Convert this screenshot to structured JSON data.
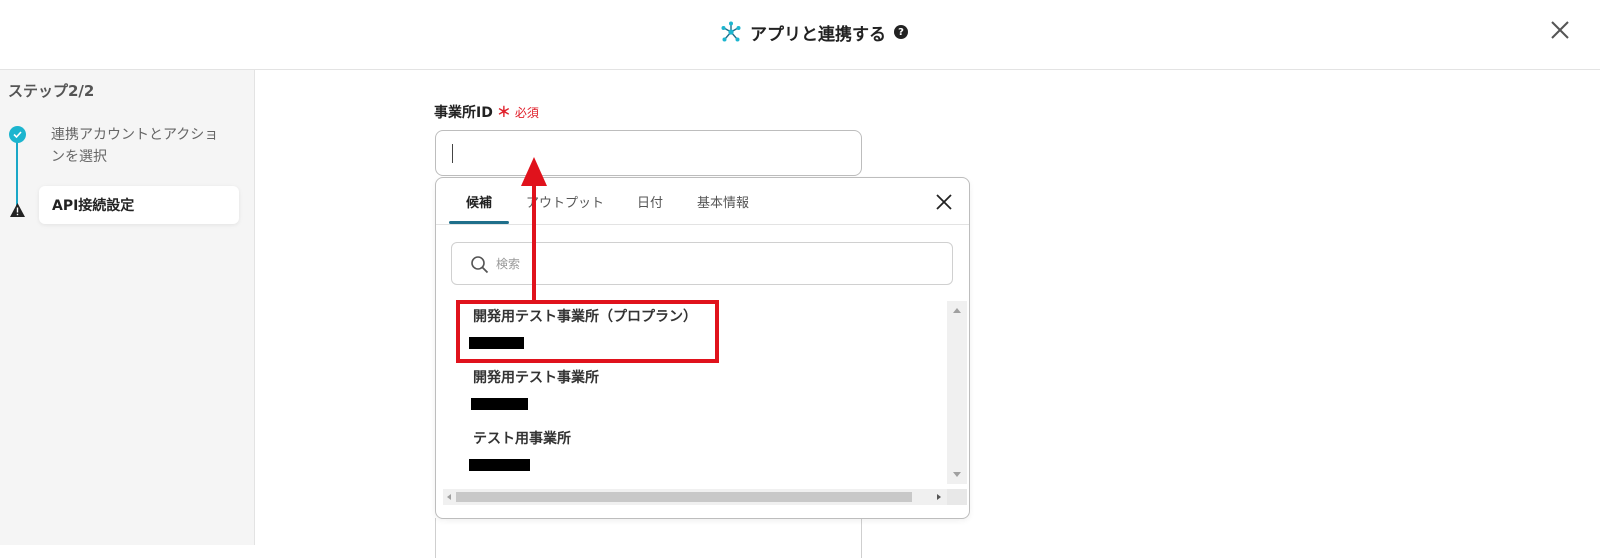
{
  "header": {
    "title": "アプリと連携する",
    "help_glyph": "?",
    "close_glyph": "×"
  },
  "sidebar": {
    "step_heading": "ステップ2/2",
    "steps": [
      {
        "label": "連携アカウントとアクションを選択",
        "status": "done"
      },
      {
        "label": "API接続設定",
        "status": "warning"
      }
    ]
  },
  "field": {
    "label": "事業所ID",
    "required_star": "＊",
    "required_text": "必須",
    "value": ""
  },
  "dropdown": {
    "tabs": [
      {
        "label": "候補",
        "active": true
      },
      {
        "label": "アウトプット",
        "active": false
      },
      {
        "label": "日付",
        "active": false
      },
      {
        "label": "基本情報",
        "active": false
      }
    ],
    "search_placeholder": "検索",
    "items": [
      {
        "label": "開発用テスト事業所（プロプラン）",
        "id_redacted": true,
        "highlighted": true
      },
      {
        "label": "開発用テスト事業所",
        "id_redacted": true,
        "highlighted": false
      },
      {
        "label": "テスト用事業所",
        "id_redacted": true,
        "highlighted": false
      }
    ]
  },
  "colors": {
    "accent": "#1cb5cf",
    "tab_underline": "#1f6f8b",
    "required": "#e0202b",
    "annotation": "#e0121c"
  }
}
